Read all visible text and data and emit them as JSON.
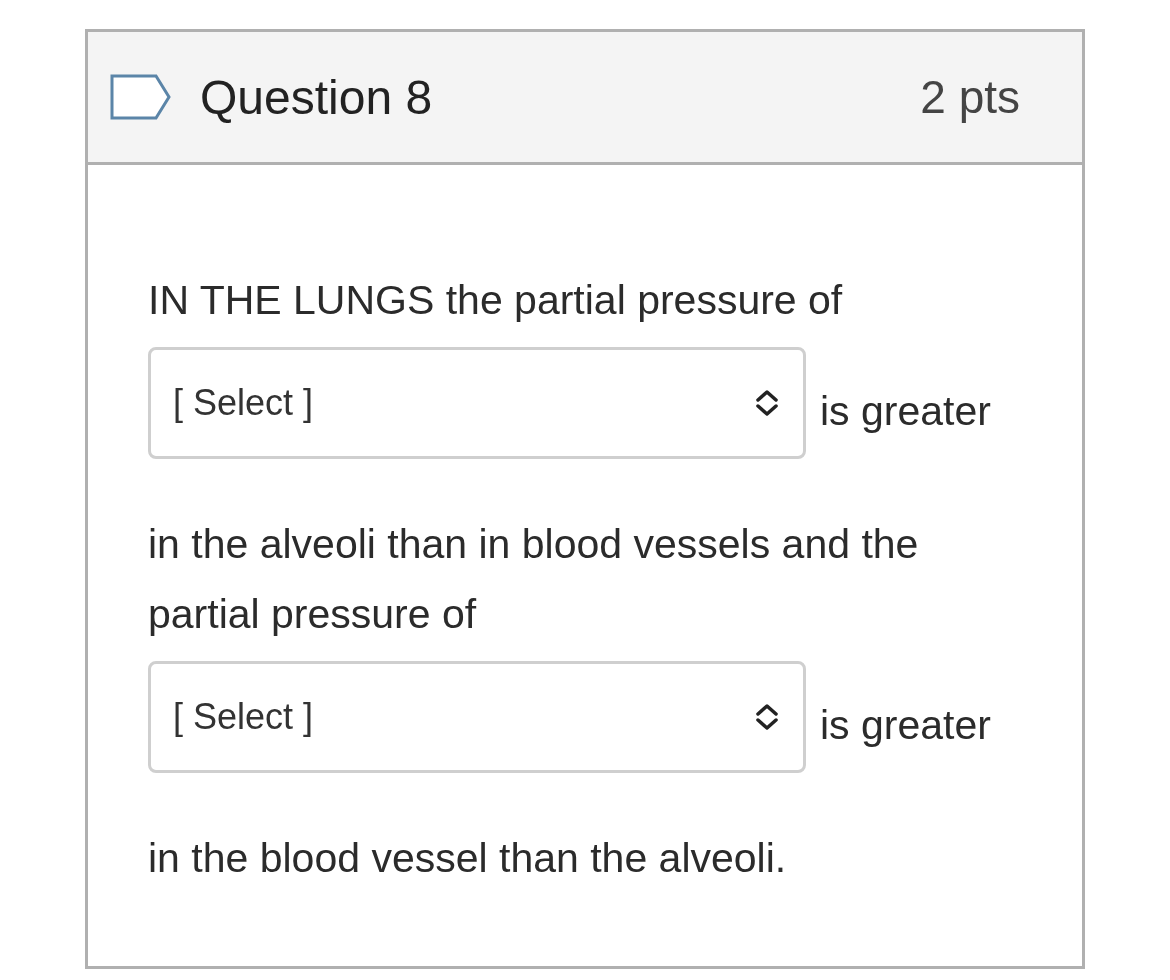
{
  "question": {
    "title": "Question 8",
    "points": "2 pts",
    "flagged": false
  },
  "body": [
    {
      "kind": "text",
      "text": "IN THE LUNGS the partial pressure of"
    },
    {
      "kind": "select",
      "placeholder": "[ Select ]",
      "after": "is greater"
    },
    {
      "kind": "text",
      "text": "in the alveoli than in blood vessels and the partial pressure of"
    },
    {
      "kind": "select",
      "placeholder": "[ Select ]",
      "after": "is greater"
    },
    {
      "kind": "text",
      "text": "in the blood vessel than the alveoli."
    }
  ]
}
